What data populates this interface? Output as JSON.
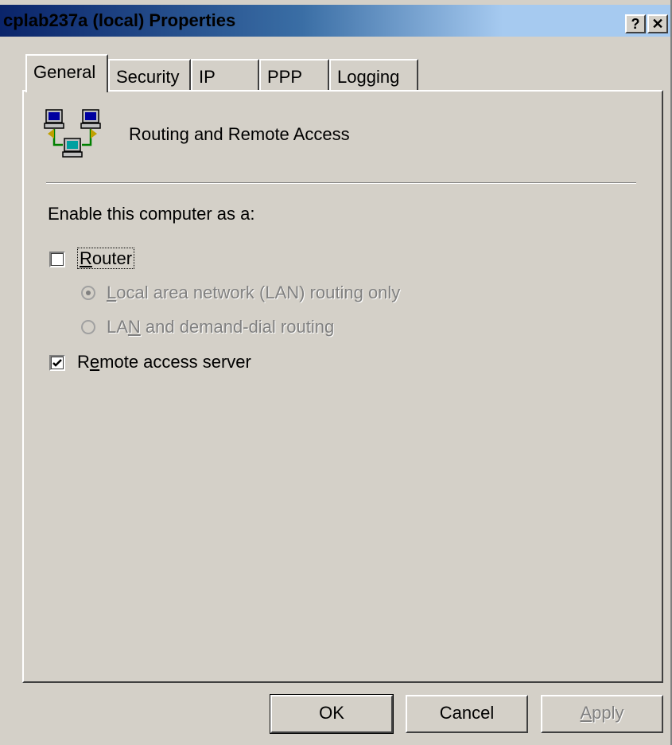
{
  "window": {
    "title": "cplab237a (local) Properties",
    "help_label": "?",
    "close_label": "✕"
  },
  "tabs": [
    {
      "label": "General",
      "active": true
    },
    {
      "label": "Security",
      "active": false
    },
    {
      "label": "IP",
      "active": false
    },
    {
      "label": "PPP",
      "active": false
    },
    {
      "label": "Logging",
      "active": false
    }
  ],
  "general": {
    "service_icon": "network-computers-icon",
    "service_title": "Routing and Remote Access",
    "enable_label": "Enable this computer as a:",
    "router": {
      "label_accel": "R",
      "label_rest": "outer",
      "checked": false
    },
    "lan_only": {
      "label_accel": "L",
      "label_rest": "ocal area network (LAN) routing only",
      "selected": true,
      "disabled": true
    },
    "lan_demand": {
      "label_pre": "LA",
      "label_accel": "N",
      "label_rest": " and demand-dial routing",
      "selected": false,
      "disabled": true
    },
    "remote_access": {
      "label_pre": "R",
      "label_accel": "e",
      "label_rest": "mote access server",
      "checked": true
    }
  },
  "buttons": {
    "ok": "OK",
    "cancel": "Cancel",
    "apply_accel": "A",
    "apply_rest": "pply"
  }
}
